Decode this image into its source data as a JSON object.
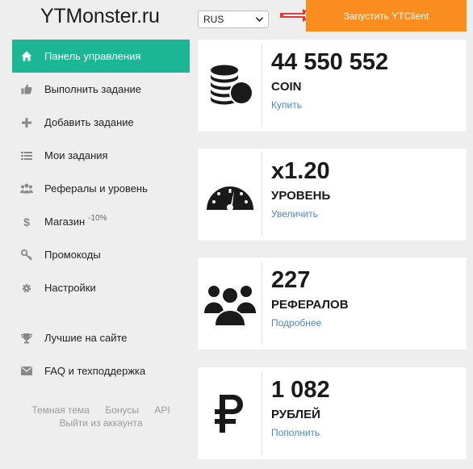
{
  "header": {
    "logo": "YTMonster.ru",
    "language": "RUS",
    "launch_button": "Запустить YTClient"
  },
  "colors": {
    "accent": "#1bb696",
    "launch": "#fa8d1f",
    "arrow": "#e53935",
    "link": "#4a88c7"
  },
  "sidebar": {
    "items": [
      {
        "label": "Панель управления",
        "icon": "home-icon"
      },
      {
        "label": "Выполнить задание",
        "icon": "thumbs-up-icon"
      },
      {
        "label": "Добавить задание",
        "icon": "plus-icon"
      },
      {
        "label": "Мои задания",
        "icon": "list-icon"
      },
      {
        "label": "Рефералы и уровень",
        "icon": "users-icon"
      },
      {
        "label": "Магазин",
        "badge": "-10%",
        "icon": "dollar-icon"
      },
      {
        "label": "Промокоды",
        "icon": "key-icon"
      },
      {
        "label": "Настройки",
        "icon": "gear-icon"
      },
      {
        "label": "Лучшие на сайте",
        "icon": "trophy-icon"
      },
      {
        "label": "FAQ и техподдержка",
        "icon": "envelope-icon"
      }
    ],
    "footer": {
      "dark_theme": "Темная тема",
      "bonuses": "Бонусы",
      "api": "API",
      "logout": "Выйти из аккаунта"
    }
  },
  "cards": {
    "coin": {
      "value": "44 550 552",
      "label": "COIN",
      "link": "Купить",
      "icon": "coins-stack-icon"
    },
    "level": {
      "value": "x1.20",
      "label": "УРОВЕНЬ",
      "link": "Увеличить",
      "icon": "speedometer-icon"
    },
    "referrals": {
      "value": "227",
      "label": "РЕФЕРАЛОВ",
      "link": "Подробнее",
      "icon": "users-group-icon"
    },
    "rubles": {
      "value": "1 082",
      "label": "РУБЛЕЙ",
      "link": "Пополнить",
      "icon": "ruble-icon"
    }
  }
}
